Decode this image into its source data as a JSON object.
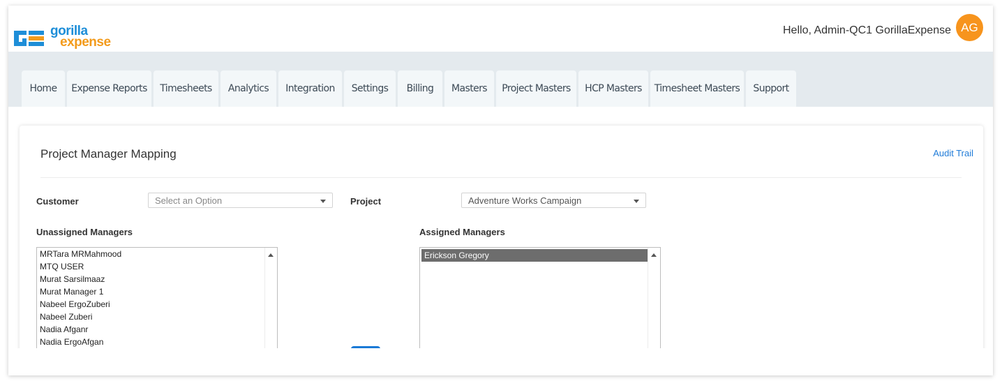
{
  "header": {
    "logo_top": "gorilla",
    "logo_bottom": "expense",
    "greeting": "Hello, Admin-QC1 GorillaExpense",
    "avatar_initials": "AG"
  },
  "nav": {
    "tabs": [
      {
        "label": "Home"
      },
      {
        "label": "Expense Reports"
      },
      {
        "label": "Timesheets"
      },
      {
        "label": "Analytics"
      },
      {
        "label": "Integration"
      },
      {
        "label": "Settings"
      },
      {
        "label": "Billing"
      },
      {
        "label": "Masters"
      },
      {
        "label": "Project Masters"
      },
      {
        "label": "HCP Masters"
      },
      {
        "label": "Timesheet Masters"
      },
      {
        "label": "Support"
      }
    ]
  },
  "page": {
    "title": "Project Manager Mapping",
    "audit_link": "Audit Trail"
  },
  "filters": {
    "customer_label": "Customer",
    "customer_value": "Select an Option",
    "project_label": "Project",
    "project_value": "Adventure Works Campaign"
  },
  "unassigned": {
    "label": "Unassigned Managers",
    "items": [
      "MRTara MRMahmood",
      "MTQ USER",
      "Murat Sarsilmaaz",
      "Murat Manager 1",
      "Nabeel ErgoZuberi",
      "Nabeel Zuberi",
      "Nadia Afganr",
      "Nadia ErgoAfgan"
    ]
  },
  "assigned": {
    "label": "Assigned Managers",
    "items": [
      "Erickson Gregory"
    ]
  },
  "colors": {
    "brand_blue": "#1e8ed8",
    "brand_orange": "#f39b1c",
    "avatar": "#f7941d",
    "link": "#1f7bd8",
    "nav_bg": "#e4eaee",
    "tab_bg": "#f3f7f9",
    "selected_item": "#6d6d6d",
    "primary_button": "#1a7ad6"
  }
}
